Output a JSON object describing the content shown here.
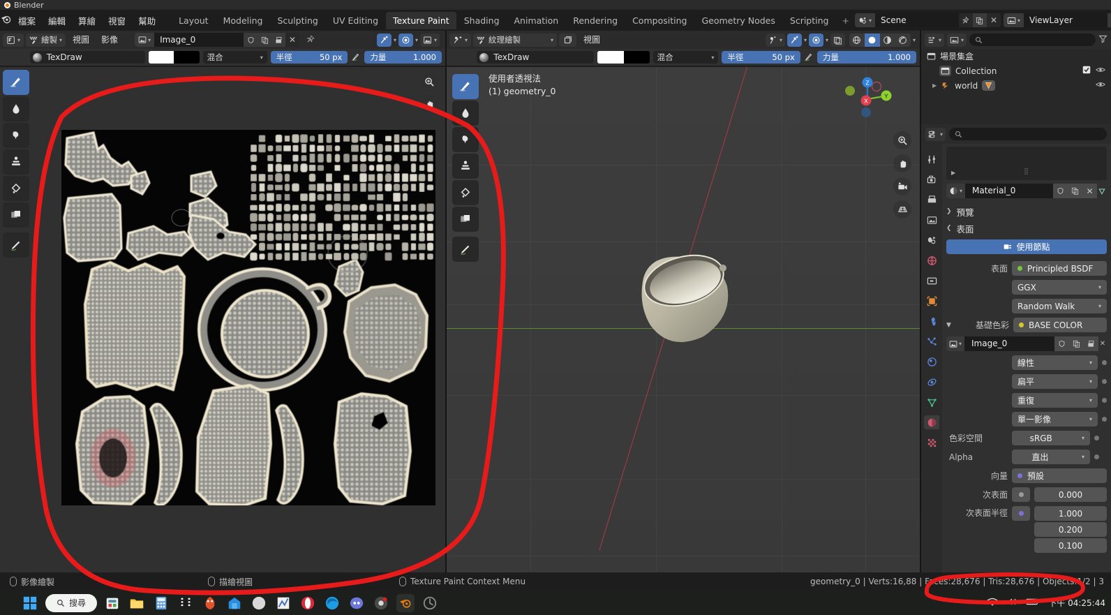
{
  "window": {
    "app_title": "Blender",
    "app_icon": "blender-logo-icon"
  },
  "menu": {
    "items": [
      "檔案",
      "編輯",
      "算繪",
      "視窗",
      "幫助"
    ]
  },
  "workspace_tabs": [
    {
      "label": "Layout",
      "active": false
    },
    {
      "label": "Modeling",
      "active": false
    },
    {
      "label": "Sculpting",
      "active": false
    },
    {
      "label": "UV Editing",
      "active": false
    },
    {
      "label": "Texture Paint",
      "active": true
    },
    {
      "label": "Shading",
      "active": false
    },
    {
      "label": "Animation",
      "active": false
    },
    {
      "label": "Rendering",
      "active": false
    },
    {
      "label": "Compositing",
      "active": false
    },
    {
      "label": "Geometry Nodes",
      "active": false
    },
    {
      "label": "Scripting",
      "active": false
    },
    {
      "label": "+",
      "active": false
    }
  ],
  "topbar_right": {
    "scene_icon": "scene-icon",
    "scene_name": "Scene",
    "pin_icon": "pin-icon",
    "copy_icon": "duplicate-icon",
    "close_icon": "x-icon",
    "viewlayer_icon": "viewlayer-icon",
    "viewlayer_name": "ViewLayer",
    "viewlayer_copy_icon": "duplicate-icon"
  },
  "image_editor": {
    "mode_icon": "uv-editor-mode-icon",
    "paint_mode_icon": "paint-mask-icon",
    "paint_mode_label": "繪製",
    "menus": [
      "視圖",
      "影像"
    ],
    "image_icon": "image-icon",
    "image_name": "Image_0",
    "shield_icon": "fake-user-icon",
    "copy_icon": "duplicate-icon",
    "pack_icon": "pack-image-icon",
    "x_icon": "unlink-icon",
    "pin_icon": "pin-icon",
    "overlay_icons": [
      "snap-icon",
      "proportional-edit-icon",
      "view-options-icon"
    ],
    "tool_settings": {
      "brush_name": "TexDraw",
      "color_primary": "#ffffff",
      "color_secondary": "#000000",
      "blend_label": "混合",
      "radius_label": "半徑",
      "radius_value": "50 px",
      "pressure_icon": "pen-pressure-icon",
      "strength_label": "力量",
      "strength_value": "1.000"
    },
    "toolbar": [
      {
        "name": "draw-tool",
        "icon": "brush-icon",
        "active": true
      },
      {
        "name": "soften-tool",
        "icon": "droplet-icon",
        "active": false
      },
      {
        "name": "smear-tool",
        "icon": "smear-icon",
        "active": false
      },
      {
        "name": "clone-tool",
        "icon": "stamp-icon",
        "active": false
      },
      {
        "name": "fill-tool",
        "icon": "paint-bucket-icon",
        "active": false
      },
      {
        "name": "mask-tool",
        "icon": "mask-icon",
        "active": false
      },
      {
        "name": "annotate-tool",
        "icon": "pencil-icon",
        "active": false
      }
    ],
    "nav": [
      "zoom-icon",
      "pan-icon"
    ]
  },
  "viewport3d": {
    "mode_icon": "texture-paint-mode-icon",
    "paint_mode_icon": "paint-mask-icon",
    "mode_label": "紋理繪製",
    "object_icon": "object-icon",
    "view_menu": "視圖",
    "header_right_icons": [
      "visibility-icon",
      "snap-icon",
      "proportional-edit-icon",
      "xray-icon"
    ],
    "shading_modes": [
      "wireframe-shading-icon",
      "solid-shading-icon",
      "material-shading-icon",
      "rendered-shading-icon"
    ],
    "active_shading_index": 1,
    "tool_settings": {
      "brush_name": "TexDraw",
      "color_primary": "#ffffff",
      "color_secondary": "#000000",
      "blend_label": "混合",
      "radius_label": "半徑",
      "radius_value": "50 px",
      "pressure_icon": "pen-pressure-icon",
      "strength_label": "力量",
      "strength_value": "1.000"
    },
    "overlay_line1": "使用者透視法",
    "overlay_line2": "(1) geometry_0",
    "gizmo_axes": {
      "z": "Z",
      "x": "X",
      "y": "Y"
    },
    "nav_icons": [
      "zoom-icon",
      "pan-icon",
      "camera-icon",
      "ortho-persp-icon"
    ],
    "toolbar": [
      {
        "name": "draw-tool",
        "icon": "brush-icon",
        "active": true
      },
      {
        "name": "soften-tool",
        "icon": "droplet-icon",
        "active": false
      },
      {
        "name": "smear-tool",
        "icon": "smear-icon",
        "active": false
      },
      {
        "name": "clone-tool",
        "icon": "stamp-icon",
        "active": false
      },
      {
        "name": "fill-tool",
        "icon": "paint-bucket-icon",
        "active": false
      },
      {
        "name": "mask-tool",
        "icon": "mask-icon",
        "active": false
      },
      {
        "name": "annotate-tool",
        "icon": "pencil-icon",
        "active": false
      }
    ]
  },
  "outliner": {
    "display_mode_icon": "outliner-display-icon",
    "filter_type_icon": "filter-type-icon",
    "search_placeholder": "",
    "search_icon": "search-icon",
    "filter_icon": "filter-funnel-icon",
    "rows": [
      {
        "indent": 0,
        "icon": "collection-icon",
        "label": "場景集盒",
        "checkbox": false,
        "eye": false
      },
      {
        "indent": 1,
        "icon": "collection-icon",
        "label": "Collection",
        "checkbox": true,
        "eye": true
      },
      {
        "indent": 1,
        "icon": "world-icon",
        "label": "world",
        "badge": "world-data-icon",
        "checkbox": false,
        "eye": true,
        "expander": true
      }
    ]
  },
  "properties": {
    "editor_icon": "properties-editor-icon",
    "search_icon": "search-icon",
    "search_placeholder": "",
    "tabs": [
      {
        "name": "tool-tab",
        "icon": "tool-icon",
        "color": "#c8c8c8",
        "active": false
      },
      {
        "name": "render-tab",
        "icon": "camera-back-icon",
        "color": "#c8c8c8",
        "active": false
      },
      {
        "name": "output-tab",
        "icon": "printer-icon",
        "color": "#c8c8c8",
        "active": false
      },
      {
        "name": "viewlayer-tab",
        "icon": "images-icon",
        "color": "#c8c8c8",
        "active": false
      },
      {
        "name": "scene-tab",
        "icon": "scene-cone-icon",
        "color": "#c8c8c8",
        "active": false
      },
      {
        "name": "world-tab",
        "icon": "world-globe-icon",
        "color": "#d05a6e",
        "active": false
      },
      {
        "name": "collection-tab",
        "icon": "collection-box-icon",
        "color": "#c8c8c8",
        "active": false
      },
      {
        "name": "object-tab",
        "icon": "object-square-icon",
        "color": "#e08b3a",
        "active": false
      },
      {
        "name": "modifier-tab",
        "icon": "wrench-icon",
        "color": "#5b86d6",
        "active": false
      },
      {
        "name": "particles-tab",
        "icon": "particles-icon",
        "color": "#5b86d6",
        "active": false
      },
      {
        "name": "physics-tab",
        "icon": "physics-orbit-icon",
        "color": "#5b86d6",
        "active": false
      },
      {
        "name": "constraints-tab",
        "icon": "constraint-icon",
        "color": "#5b86d6",
        "active": false
      },
      {
        "name": "data-tab",
        "icon": "mesh-data-icon",
        "color": "#4bbf8a",
        "active": false
      },
      {
        "name": "material-tab",
        "icon": "material-sphere-icon",
        "color": "#d05a6e",
        "active": true
      },
      {
        "name": "texture-tab",
        "icon": "checker-texture-icon",
        "color": "#d05a6e",
        "active": false
      }
    ],
    "material_id": {
      "browse_icon": "material-sphere-icon",
      "name": "Material_0",
      "shield_icon": "fake-user-icon",
      "copy_icon": "duplicate-icon",
      "close_icon": "x-icon",
      "slot_icon": "material-slot-icon"
    },
    "panels": [
      {
        "name": "preview-panel",
        "label": "預覽",
        "expanded": false
      },
      {
        "name": "surface-panel",
        "label": "表面",
        "expanded": true
      }
    ],
    "use_nodes": {
      "label": "使用節點",
      "icon": "nodetree-icon",
      "color": "#4772b3"
    },
    "surface": {
      "surface_label": "表面",
      "surface_value": "Principled BSDF",
      "surface_dot": "#76c442",
      "distribution": "GGX",
      "subsurface_method": "Random Walk",
      "base_color_label": "基礎色彩",
      "base_color_value": "BASE COLOR",
      "base_color_dot": "#d5c72a",
      "image_icon": "image-icon",
      "image_name": "Image_0",
      "image_shield_icon": "fake-user-icon",
      "image_copy_icon": "duplicate-icon",
      "image_pack_icon": "pack-image-icon",
      "interpolation": "線性",
      "projection": "扁平",
      "extension": "重復",
      "source": "單一影像",
      "colorspace_label": "色彩空間",
      "colorspace_value": "sRGB",
      "alpha_label": "Alpha",
      "alpha_value": "直出",
      "vector_label": "向量",
      "vector_value": "預設",
      "vector_dot": "#7a72d8",
      "subsurface_label": "次表面",
      "subsurface_value": "0.000",
      "subsurface_dot": "#9a9a9a",
      "subsurface_radius_label": "次表面半徑",
      "subsurface_radius_dot": "#7a72d8",
      "subsurface_radius_values": [
        "1.000",
        "0.200",
        "0.100"
      ]
    }
  },
  "statusbar": {
    "hints": [
      {
        "icon": "mouse-left-icon",
        "label": "影像繪製"
      },
      {
        "icon": "mouse-middle-icon",
        "label": "描繪視圖"
      },
      {
        "icon": "mouse-right-icon",
        "label": "Texture Paint Context Menu"
      }
    ],
    "scene_stats": "geometry_0 | Verts:16,88 | Faces:28,676 | Tris:28,676 | Objects:1/2 | 3",
    "stats_parts": {
      "object": "geometry_0",
      "verts": "Verts:16,88",
      "faces": "Faces:28,676",
      "tris": "Tris:28,676",
      "objects": "Objects:1/2",
      "trailing": "3,"
    }
  },
  "taskbar": {
    "start_icon": "windows-start-icon",
    "search_label": "搜尋",
    "search_icon": "search-icon",
    "apps": [
      {
        "name": "store-icon",
        "color": "#f0f0f0"
      },
      {
        "name": "file-explorer-icon",
        "color": "#ffc83d"
      },
      {
        "name": "calculator-icon",
        "color": "#5b9bd5"
      },
      {
        "name": "media-player-icon",
        "color": "#2b2b2b"
      },
      {
        "name": "meshlab-icon",
        "color": "#e0532b"
      },
      {
        "name": "onedrive-icon",
        "color": "#2a8ee0"
      },
      {
        "name": "compass-icon",
        "color": "#d8d8d8"
      },
      {
        "name": "chart-app-icon",
        "color": "#3c6fbd"
      },
      {
        "name": "opera-icon",
        "color": "#e0283c"
      },
      {
        "name": "edge-icon",
        "color": "#1e9ce0"
      },
      {
        "name": "discord-icon",
        "color": "#6b78d6"
      },
      {
        "name": "chrome-icon",
        "color": "#4a4a4a"
      },
      {
        "name": "blender-taskbar-icon",
        "color": "#e87d0d"
      },
      {
        "name": "app-extra-icon",
        "color": "#8a8a8a"
      }
    ],
    "tray_icons": [
      "wifi-icon",
      "volume-icon",
      "battery-icon"
    ],
    "clock": "下午 04:25:44"
  },
  "annotation": {
    "color": "#e81b1b",
    "shapes": [
      "large-oval-around-uv-image",
      "oval-around-face-tri-stats"
    ]
  }
}
